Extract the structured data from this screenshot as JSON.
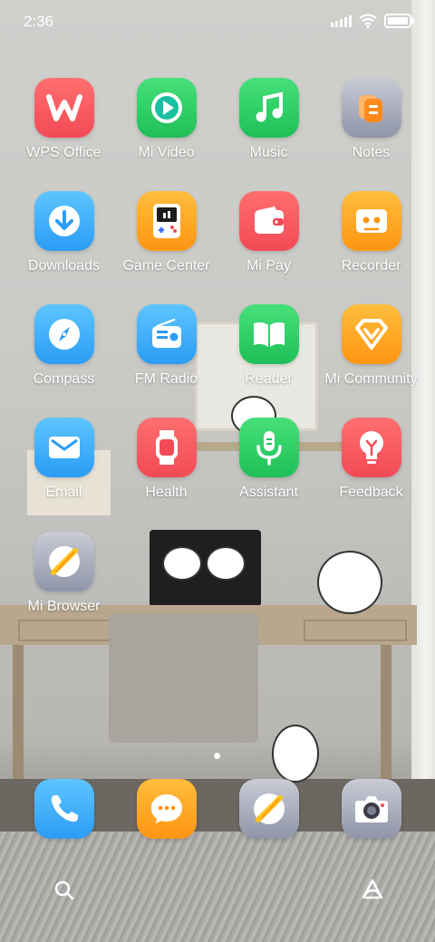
{
  "status_bar": {
    "time": "2:36"
  },
  "apps": [
    {
      "label": "WPS Office"
    },
    {
      "label": "Mi Video"
    },
    {
      "label": "Music"
    },
    {
      "label": "Notes"
    },
    {
      "label": "Downloads"
    },
    {
      "label": "Game Center"
    },
    {
      "label": "Mi Pay"
    },
    {
      "label": "Recorder"
    },
    {
      "label": "Compass"
    },
    {
      "label": "FM Radio"
    },
    {
      "label": "Reader"
    },
    {
      "label": "Mi Community"
    },
    {
      "label": "Email"
    },
    {
      "label": "Health"
    },
    {
      "label": "Assistant"
    },
    {
      "label": "Feedback"
    },
    {
      "label": "Mi Browser"
    }
  ],
  "dock": [
    "phone-icon",
    "messaging-icon",
    "browser-icon",
    "camera-icon"
  ],
  "colors": {
    "red": "#f24a56",
    "green": "#1fbf57",
    "blue": "#2b9cf5",
    "orange": "#ff9512",
    "silver": "#8f95a8"
  },
  "page_indicator": {
    "pages": 1,
    "current": 1
  }
}
